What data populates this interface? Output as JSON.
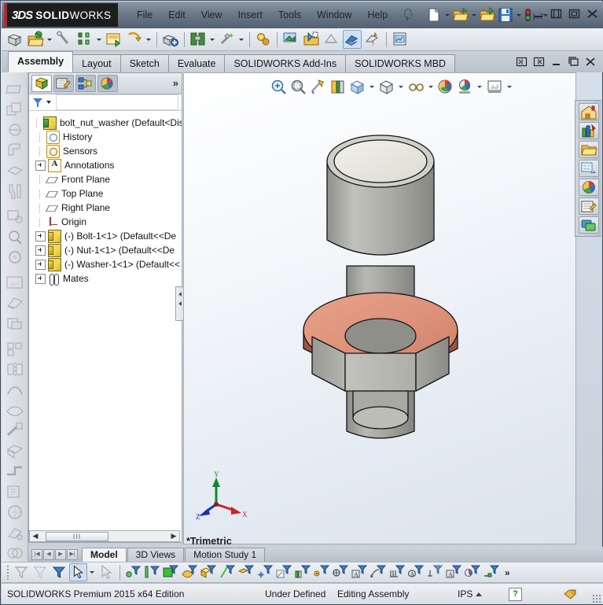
{
  "app": {
    "brand_ds": "3DS",
    "brand_name_bold": "SOLID",
    "brand_name_light": "WORKS",
    "accent_color": "#b8272d",
    "titlebar_color": "#6d7b8b"
  },
  "menu": {
    "items": [
      {
        "label": "File",
        "name": "menu-file"
      },
      {
        "label": "Edit",
        "name": "menu-edit"
      },
      {
        "label": "View",
        "name": "menu-view"
      },
      {
        "label": "Insert",
        "name": "menu-insert"
      },
      {
        "label": "Tools",
        "name": "menu-tools"
      },
      {
        "label": "Window",
        "name": "menu-window"
      },
      {
        "label": "Help",
        "name": "menu-help"
      }
    ],
    "pin_icon": "pushpin-icon",
    "quick_access": [
      {
        "name": "new-document-icon",
        "has_dropdown": true
      },
      {
        "name": "open-document-icon",
        "has_dropdown": true
      },
      {
        "name": "open-recent-icon",
        "has_dropdown": false
      },
      {
        "name": "save-icon",
        "has_dropdown": true
      },
      {
        "name": "options-icon",
        "has_dropdown": true
      }
    ],
    "window_controls": [
      {
        "name": "minimize-window-button",
        "glyph": "—"
      },
      {
        "name": "restore-window-button",
        "glyph": "▣"
      },
      {
        "name": "maximize-window-button",
        "glyph": "◻"
      },
      {
        "name": "close-window-button",
        "glyph": "✕"
      }
    ]
  },
  "command_toolbar": {
    "icons": [
      {
        "name": "insert-components-icon",
        "dropdown": false
      },
      {
        "name": "edit-component-icon",
        "dropdown": true
      },
      {
        "name": "linear-component-pattern-icon",
        "dropdown": false
      },
      {
        "name": "smart-fasteners-icon",
        "dropdown": true
      },
      {
        "name": "move-component-icon",
        "dropdown": false
      },
      {
        "name": "show-hidden-components-icon",
        "dropdown": true
      },
      {
        "name": "assembly-features-icon",
        "dropdown": true
      },
      {
        "name": "reference-geometry-icon",
        "dropdown": true
      },
      {
        "name": "new-motion-study-icon",
        "dropdown": false
      },
      {
        "name": "bill-of-materials-icon",
        "dropdown": false
      },
      {
        "name": "exploded-view-icon",
        "dropdown": false
      },
      {
        "name": "explode-line-sketch-icon",
        "dropdown": false
      },
      {
        "name": "interference-detection-icon",
        "dropdown": false,
        "selected": true
      },
      {
        "name": "clearance-verification-icon",
        "dropdown": false
      },
      {
        "name": "hole-alignment-icon",
        "dropdown": false
      }
    ]
  },
  "ribbon_tabs": {
    "items": [
      {
        "label": "Assembly",
        "name": "tab-assembly",
        "active": true
      },
      {
        "label": "Layout",
        "name": "tab-layout",
        "active": false
      },
      {
        "label": "Sketch",
        "name": "tab-sketch",
        "active": false
      },
      {
        "label": "Evaluate",
        "name": "tab-evaluate",
        "active": false
      },
      {
        "label": "SOLIDWORKS Add-Ins",
        "name": "tab-solidworks-add-ins",
        "active": false
      },
      {
        "label": "SOLIDWORKS MBD",
        "name": "tab-solidworks-mbd",
        "active": false
      }
    ],
    "document_controls": [
      {
        "name": "document-restore-left-button"
      },
      {
        "name": "document-restore-right-button"
      },
      {
        "name": "document-minimize-button"
      },
      {
        "name": "document-maximize-button"
      },
      {
        "name": "document-close-button"
      }
    ]
  },
  "feature_manager": {
    "tabs": [
      {
        "name": "feature-manager-design-tree-tab",
        "active": true
      },
      {
        "name": "property-manager-tab",
        "active": false
      },
      {
        "name": "configuration-manager-tab",
        "active": false
      },
      {
        "name": "display-manager-tab",
        "active": false
      }
    ],
    "expand_chevron": "»",
    "filter_icon": "filter-funnel-icon",
    "tree": [
      {
        "label": "bolt_nut_washer  (Default<Disp",
        "icon": "assembly-icon",
        "indent": 0,
        "expandable": false,
        "name": "tree-item-assembly-root"
      },
      {
        "label": "History",
        "icon": "history-icon",
        "indent": 1,
        "expandable": false,
        "name": "tree-item-history"
      },
      {
        "label": "Sensors",
        "icon": "sensors-icon",
        "indent": 1,
        "expandable": false,
        "name": "tree-item-sensors"
      },
      {
        "label": "Annotations",
        "icon": "annotations-icon",
        "indent": 1,
        "expandable": true,
        "name": "tree-item-annotations"
      },
      {
        "label": "Front Plane",
        "icon": "plane-icon",
        "indent": 1,
        "expandable": false,
        "name": "tree-item-front-plane"
      },
      {
        "label": "Top Plane",
        "icon": "plane-icon",
        "indent": 1,
        "expandable": false,
        "name": "tree-item-top-plane"
      },
      {
        "label": "Right Plane",
        "icon": "plane-icon",
        "indent": 1,
        "expandable": false,
        "name": "tree-item-right-plane"
      },
      {
        "label": "Origin",
        "icon": "origin-icon",
        "indent": 1,
        "expandable": false,
        "name": "tree-item-origin"
      },
      {
        "label": "(-) Bolt-1<1>  (Default<<De",
        "icon": "part-icon",
        "indent": 1,
        "expandable": true,
        "name": "tree-item-bolt"
      },
      {
        "label": "(-) Nut-1<1>  (Default<<De",
        "icon": "part-icon",
        "indent": 1,
        "expandable": true,
        "name": "tree-item-nut"
      },
      {
        "label": "(-) Washer-1<1>  (Default<<",
        "icon": "part-icon",
        "indent": 1,
        "expandable": true,
        "name": "tree-item-washer"
      },
      {
        "label": "Mates",
        "icon": "mates-icon",
        "indent": 1,
        "expandable": true,
        "name": "tree-item-mates"
      }
    ],
    "hscroll": {
      "left_arrow": "◀",
      "right_arrow": "▶",
      "thumb_glyph": "III"
    }
  },
  "view_toolbar": {
    "icons": [
      {
        "name": "zoom-to-fit-icon",
        "dropdown": false
      },
      {
        "name": "zoom-to-area-icon",
        "dropdown": false
      },
      {
        "name": "previous-view-icon",
        "dropdown": false
      },
      {
        "name": "section-view-icon",
        "dropdown": false
      },
      {
        "name": "view-orientation-icon",
        "dropdown": true
      },
      {
        "name": "display-style-icon",
        "dropdown": true
      },
      {
        "name": "hide-show-items-icon",
        "dropdown": true
      },
      {
        "name": "edit-appearance-icon",
        "dropdown": false
      },
      {
        "name": "apply-scene-icon",
        "dropdown": true
      },
      {
        "name": "view-settings-icon",
        "dropdown": true
      }
    ]
  },
  "graphics": {
    "view_name": "*Trimetric",
    "triad": {
      "x_label": "X",
      "y_label": "Y",
      "z_label": "Z",
      "x_color": "#cc2026",
      "y_color": "#0f8a2e",
      "z_color": "#1a33b0"
    },
    "model": {
      "name": "bolt-nut-washer-assembly",
      "bolt_color": "#a8a8a3",
      "bolt_top_color": "#ebeae2",
      "washer_color": "#dd9179",
      "washer_edge_color": "#8f4a34",
      "nut_color": "#b3b3ae",
      "edge_color": "#1a1a1a"
    }
  },
  "task_pane": {
    "icons": [
      {
        "name": "solidworks-resources-icon"
      },
      {
        "name": "design-library-icon"
      },
      {
        "name": "file-explorer-icon"
      },
      {
        "name": "view-palette-icon"
      },
      {
        "name": "appearances-scenes-decals-icon"
      },
      {
        "name": "custom-properties-icon"
      },
      {
        "name": "solidworks-forum-icon"
      }
    ]
  },
  "bottom_tabs": {
    "nav_buttons": [
      {
        "name": "first-tab-button",
        "glyph": "|◀"
      },
      {
        "name": "previous-tab-button",
        "glyph": "◀"
      },
      {
        "name": "next-tab-button",
        "glyph": "▶"
      },
      {
        "name": "last-tab-button",
        "glyph": "▶|"
      }
    ],
    "tabs": [
      {
        "label": "Model",
        "name": "bottom-tab-model",
        "active": true
      },
      {
        "label": "3D Views",
        "name": "bottom-tab-3d-views",
        "active": false
      },
      {
        "label": "Motion Study 1",
        "name": "bottom-tab-motion-study-1",
        "active": false
      }
    ]
  },
  "selection_filter_bar": {
    "icons": [
      {
        "name": "filter-off-icon",
        "selected": false
      },
      {
        "name": "clear-all-filters-icon",
        "selected": false
      },
      {
        "name": "toggle-selection-filter-toolbar-icon",
        "selected": false
      },
      {
        "name": "select-pointer-icon",
        "selected": true,
        "dropdown": true
      },
      {
        "name": "select-other-icon",
        "selected": false
      },
      {
        "name": "filter-vertices-icon",
        "selected": false
      },
      {
        "name": "filter-edges-icon",
        "selected": false
      },
      {
        "name": "filter-faces-icon",
        "selected": false
      },
      {
        "name": "filter-surface-bodies-icon",
        "selected": false
      },
      {
        "name": "filter-solid-bodies-icon",
        "selected": false
      },
      {
        "name": "filter-axes-icon",
        "selected": false
      },
      {
        "name": "filter-planes-icon",
        "selected": false
      },
      {
        "name": "filter-sketch-points-icon",
        "selected": false
      },
      {
        "name": "filter-sketches-icon",
        "selected": false
      },
      {
        "name": "filter-sketch-segments-icon",
        "selected": false
      },
      {
        "name": "filter-midpoints-icon",
        "selected": false
      },
      {
        "name": "filter-center-marks-icon",
        "selected": false
      },
      {
        "name": "filter-centerlines-icon",
        "selected": false
      },
      {
        "name": "filter-dimensions-icon",
        "selected": false
      },
      {
        "name": "filter-surface-finish-icon",
        "selected": false
      },
      {
        "name": "filter-weld-symbols-icon",
        "selected": false
      },
      {
        "name": "filter-datums-icon",
        "selected": false
      },
      {
        "name": "filter-notes-icon",
        "selected": false
      },
      {
        "name": "filter-balloons-icon",
        "selected": false
      },
      {
        "name": "filter-geometric-tolerances-icon",
        "selected": false
      },
      {
        "name": "filter-cosmetic-threads-icon",
        "selected": false
      },
      {
        "name": "filter-blocks-icon",
        "selected": false
      },
      {
        "name": "filter-dowel-symbols-icon",
        "selected": false
      },
      {
        "name": "filter-connection-points-icon",
        "selected": false
      }
    ],
    "overflow_chevron": "»"
  },
  "status_bar": {
    "edition": "SOLIDWORKS Premium 2015 x64 Edition",
    "state": "Under Defined",
    "mode": "Editing Assembly",
    "units": "IPS",
    "units_arrow": "▲",
    "help_glyph": "?",
    "tag_icon": "tag-icon",
    "resize_grip": "resize-grip-icon"
  }
}
